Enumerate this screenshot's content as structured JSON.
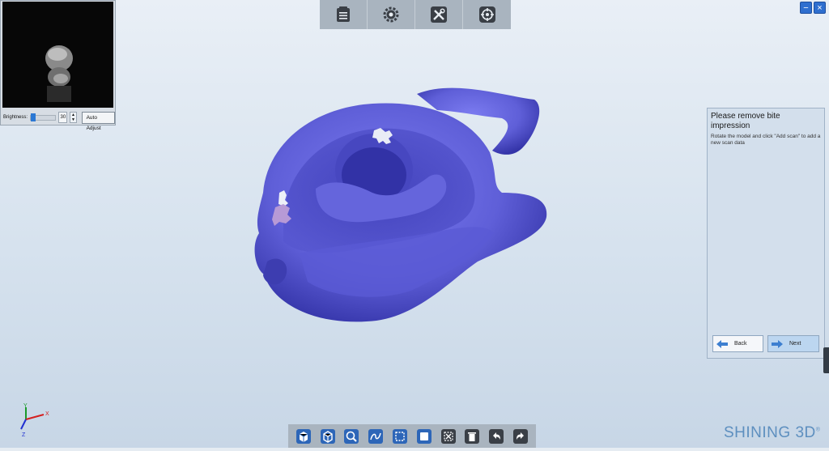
{
  "preview": {
    "brightness_label": "Brightness:",
    "brightness_value": "30",
    "auto_adjust_label": "Auto Adjust"
  },
  "top_toolbar": {
    "items": [
      {
        "icon": "clipboard-icon"
      },
      {
        "icon": "gear-icon"
      },
      {
        "icon": "tools-icon"
      },
      {
        "icon": "crosshair-icon"
      }
    ]
  },
  "window_controls": {
    "minimize": "−",
    "close": "×"
  },
  "panel": {
    "title": "Please remove bite impression",
    "description": "Rotate the model and click \"Add scan\" to add a new scan data",
    "back_label": "Back",
    "next_label": "Next"
  },
  "axes": {
    "x": "X",
    "y": "Y",
    "z": "Z"
  },
  "bottom_toolbar": {
    "items": [
      {
        "icon": "view-front-icon"
      },
      {
        "icon": "view-cube-icon"
      },
      {
        "icon": "zoom-icon"
      },
      {
        "icon": "curve-select-icon"
      },
      {
        "icon": "rect-select-icon"
      },
      {
        "icon": "select-all-icon"
      },
      {
        "icon": "deselect-icon"
      },
      {
        "icon": "delete-icon"
      },
      {
        "icon": "undo-icon"
      },
      {
        "icon": "redo-icon"
      }
    ]
  },
  "brand": {
    "name": "SHINING 3D",
    "mark": "®"
  },
  "colors": {
    "model": "#5f5fd8",
    "accent": "#2f6fcf",
    "brand": "#5d8fbf"
  }
}
